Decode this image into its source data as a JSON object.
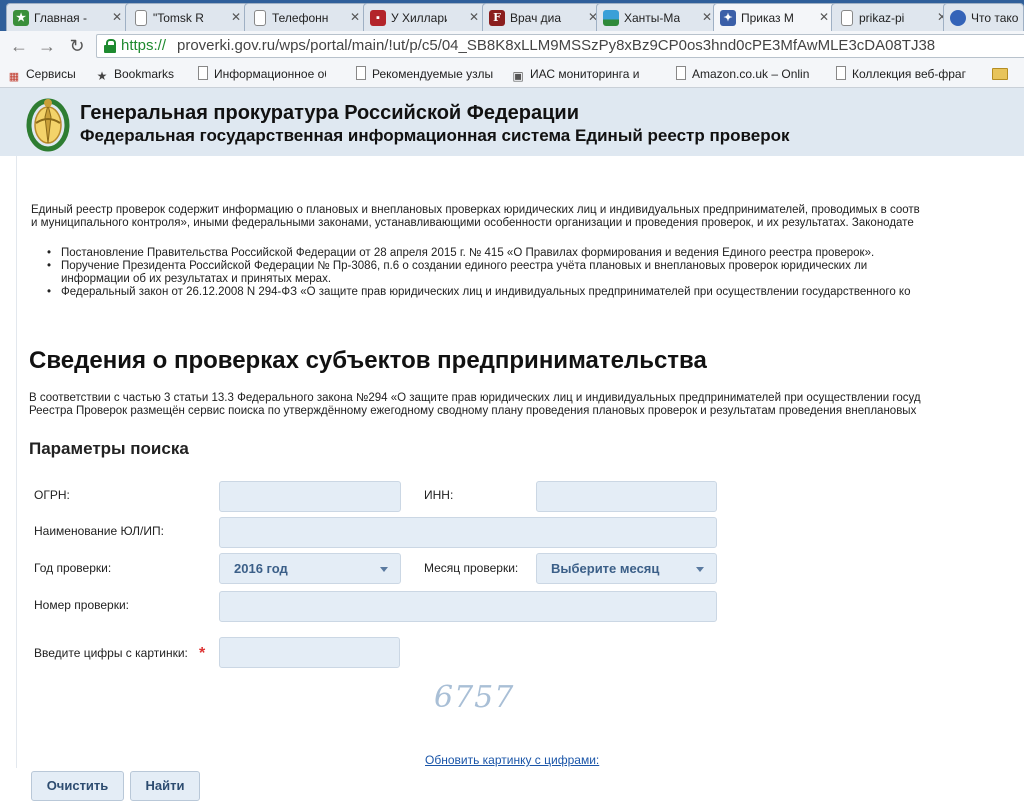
{
  "tabs": [
    {
      "label": "Главная -",
      "icon": "green-star-favicon-icon",
      "color": "#3a8f3a",
      "glyph": "★"
    },
    {
      "label": "\"Tomsk R",
      "icon": "document-icon",
      "color": "#ffffff",
      "glyph": ""
    },
    {
      "label": "Телефонн",
      "icon": "document-icon",
      "color": "#ffffff",
      "glyph": ""
    },
    {
      "label": "У Хиллари",
      "icon": "red-news-favicon-icon",
      "color": "#b3242a",
      "glyph": "▪"
    },
    {
      "label": "Врач диа",
      "icon": "letter-f-favicon-icon",
      "color": "#8a1e1e",
      "glyph": "F"
    },
    {
      "label": "Ханты-Ма",
      "icon": "flag-favicon-icon",
      "color": "#3aa0d8",
      "glyph": "▬"
    },
    {
      "label": "Приказ M",
      "icon": "eagle-favicon-icon",
      "color": "#3b5fa8",
      "glyph": "✦"
    },
    {
      "label": "prikaz-pi",
      "icon": "document-icon",
      "color": "#ffffff",
      "glyph": ""
    },
    {
      "label": "Что тако",
      "icon": "globe-favicon-icon",
      "color": "#3463b8",
      "glyph": "●"
    }
  ],
  "url": {
    "scheme": "https://",
    "rest": "proverki.gov.ru/wps/portal/main/!ut/p/c5/04_SB8K8xLLM9MSSzPy8xBz9CP0os3hnd0cPE3MfAwMLE3cDA08TJ38"
  },
  "bookmarks": [
    {
      "label": "Сервисы",
      "icon": "apps-grid-icon"
    },
    {
      "label": "Bookmarks",
      "icon": "star-icon"
    },
    {
      "label": "Информационное об",
      "icon": "document-icon"
    },
    {
      "label": "Рекомендуемые узлы",
      "icon": "document-icon"
    },
    {
      "label": "ИАС мониторинга и",
      "icon": "monitor-icon"
    },
    {
      "label": "Amazon.co.uk – Onlin",
      "icon": "document-icon"
    },
    {
      "label": "Коллекция веб-фраг",
      "icon": "document-icon"
    },
    {
      "label": "",
      "icon": "folder-icon"
    }
  ],
  "header": {
    "title": "Генеральная прокуратура Российской Федерации",
    "subtitle": "Федеральная государственная информационная система Единый реестр проверок"
  },
  "intro": {
    "line1": "Единый реестр проверок содержит информацию о плановых и внеплановых проверках юридических лиц и индивидуальных предпринимателей, проводимых в соотв",
    "line2": "и муниципального контроля», иными федеральными законами, устанавливающими особенности организации и проведения проверок, и их результатах. Законодате",
    "bullets": [
      {
        "text": "Постановление Правительства Российской Федерации от 28 апреля 2015 г. № 415 «О Правилах формирования и ведения Единого реестра проверок».",
        "cont": ""
      },
      {
        "text": "Поручение Президента Российской Федерации № Пр-3086, п.6 о создании единого реестра учёта плановых и внеплановых проверок юридических ли",
        "cont": "информации об их результатах и принятых мерах."
      },
      {
        "text": "Федеральный закон от 26.12.2008 N 294-ФЗ «О защите прав юридических лиц и индивидуальных предпринимателей при осуществлении государственного ко",
        "cont": ""
      }
    ]
  },
  "section": {
    "title": "Сведения о проверках субъектов предпринимательства",
    "desc1": "В соответствии с частью 3 статьи 13.3 Федерального закона №294 «О защите прав юридических лиц и индивидуальных предпринимателей при осуществлении госуд",
    "desc2": "Реестра Проверок размещён сервис поиска по утверждённому ежегодному сводному плану проведения плановых проверок и результатам проведения внеплановых"
  },
  "search": {
    "title": "Параметры поиска",
    "ogrn_label": "ОГРН:",
    "ogrn_value": "",
    "inn_label": "ИНН:",
    "inn_value": "",
    "name_label": "Наименование ЮЛ/ИП:",
    "name_value": "",
    "year_label": "Год проверки:",
    "year_value": "2016 год",
    "month_label": "Месяц проверки:",
    "month_value": "Выберите месяц",
    "number_label": "Номер проверки:",
    "number_value": "",
    "captcha_label": "Введите цифры с картинки:",
    "captcha_required": "*",
    "captcha_value": "",
    "captcha_digits": "6757",
    "refresh_link": "Обновить картинку с цифрами:",
    "clear_button": "Очистить",
    "find_button": "Найти"
  }
}
